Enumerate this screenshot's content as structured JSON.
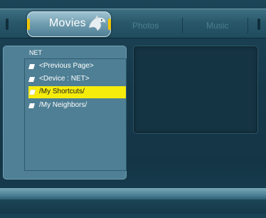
{
  "tabs": {
    "active": {
      "label": "Movies"
    },
    "photos": {
      "label": "Photos"
    },
    "music": {
      "label": "Music"
    }
  },
  "browser": {
    "title": "NET",
    "items": [
      {
        "label": "<Previous Page>",
        "icon": "folder-icon",
        "selected": false
      },
      {
        "label": "<Device : NET>",
        "icon": "folder-icon",
        "selected": false
      },
      {
        "label": "/My  Shortcuts/",
        "icon": "folder-icon",
        "selected": true
      },
      {
        "label": "/My  Neighbors/",
        "icon": "folder-icon",
        "selected": false
      }
    ]
  },
  "colors": {
    "selection_highlight": "#f6ec0c",
    "tab_cap": "#f2c400",
    "panel": "#4f8095",
    "background": "#163a4c"
  }
}
